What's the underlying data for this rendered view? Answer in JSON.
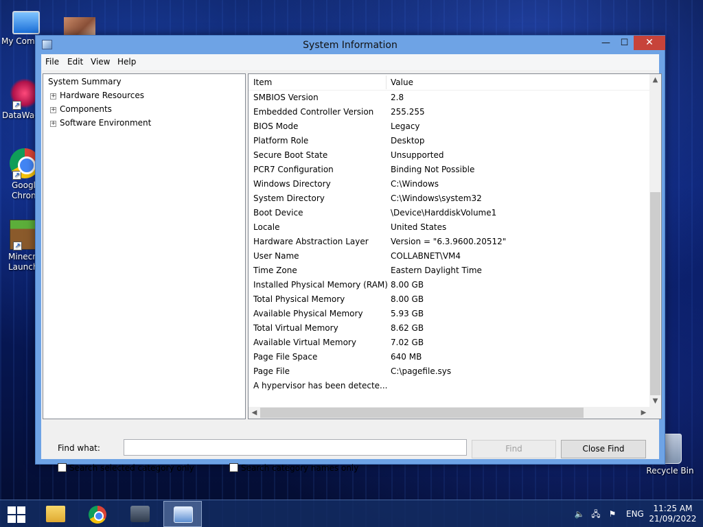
{
  "desktop": {
    "icons": [
      {
        "label": "My Comp"
      },
      {
        "label": "DataWag"
      },
      {
        "label": "Googl Chron"
      },
      {
        "label": "Minecr Launch"
      },
      {
        "label": "Recycle Bin"
      }
    ]
  },
  "window": {
    "title": "System Information",
    "controls": {
      "minimize": "—",
      "maximize": "☐",
      "close": "✕"
    },
    "menu": [
      "File",
      "Edit",
      "View",
      "Help"
    ],
    "tree": {
      "root": "System Summary",
      "nodes": [
        {
          "label": "Hardware Resources",
          "expander": "+"
        },
        {
          "label": "Components",
          "expander": "+"
        },
        {
          "label": "Software Environment",
          "expander": "+"
        }
      ]
    },
    "list": {
      "headers": {
        "item": "Item",
        "value": "Value"
      },
      "rows": [
        {
          "item": "SMBIOS Version",
          "value": "2.8"
        },
        {
          "item": "Embedded Controller Version",
          "value": "255.255"
        },
        {
          "item": "BIOS Mode",
          "value": "Legacy"
        },
        {
          "item": "Platform Role",
          "value": "Desktop"
        },
        {
          "item": "Secure Boot State",
          "value": "Unsupported"
        },
        {
          "item": "PCR7 Configuration",
          "value": "Binding Not Possible"
        },
        {
          "item": "Windows Directory",
          "value": "C:\\Windows"
        },
        {
          "item": "System Directory",
          "value": "C:\\Windows\\system32"
        },
        {
          "item": "Boot Device",
          "value": "\\Device\\HarddiskVolume1"
        },
        {
          "item": "Locale",
          "value": "United States"
        },
        {
          "item": "Hardware Abstraction Layer",
          "value": "Version = \"6.3.9600.20512\""
        },
        {
          "item": "User Name",
          "value": "COLLABNET\\VM4"
        },
        {
          "item": "Time Zone",
          "value": "Eastern Daylight Time"
        },
        {
          "item": "Installed Physical Memory (RAM)",
          "value": "8.00 GB"
        },
        {
          "item": "Total Physical Memory",
          "value": "8.00 GB"
        },
        {
          "item": "Available Physical Memory",
          "value": "5.93 GB"
        },
        {
          "item": "Total Virtual Memory",
          "value": "8.62 GB"
        },
        {
          "item": "Available Virtual Memory",
          "value": "7.02 GB"
        },
        {
          "item": "Page File Space",
          "value": "640 MB"
        },
        {
          "item": "Page File",
          "value": "C:\\pagefile.sys"
        },
        {
          "item": "A hypervisor has been detecte...",
          "value": ""
        }
      ]
    },
    "find": {
      "label": "Find what:",
      "value": "",
      "find_button": "Find",
      "close_find_button": "Close Find",
      "check_selected": "Search selected category only",
      "check_names": "Search category names only"
    }
  },
  "taskbar": {
    "language": "ENG",
    "time": "11:25 AM",
    "date": "21/09/2022"
  }
}
